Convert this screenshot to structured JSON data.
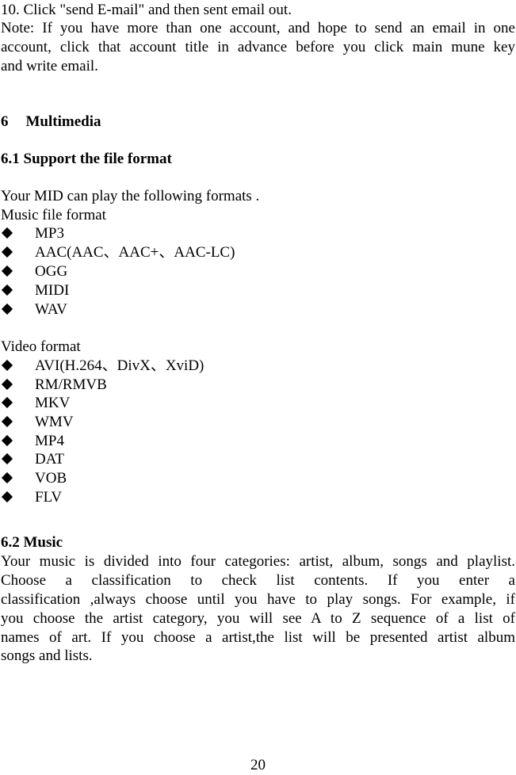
{
  "intro": {
    "step10": "10. Click \"send E-mail\" and then sent email out.",
    "note_lines": [
      "Note: If you have more than one account, and hope to send an email in one",
      "account, click that account title in advance before you click main mune key",
      "and write email."
    ]
  },
  "section6": {
    "heading_number": "6",
    "heading_title": "Multimedia"
  },
  "section6_1": {
    "heading": "6.1 Support the file format",
    "intro": "Your MID can play the following formats .",
    "music_label": "Music file format",
    "music_formats": [
      "MP3",
      "AAC(AAC、AAC+、AAC-LC)",
      "OGG",
      "MIDI",
      "WAV"
    ],
    "video_label": "Video format",
    "video_formats": [
      "AVI(H.264、DivX、XviD)",
      "RM/RMVB",
      "MKV",
      "WMV",
      "MP4",
      "DAT",
      "VOB",
      "FLV"
    ]
  },
  "section6_2": {
    "heading": "6.2 Music",
    "body_lines": [
      "Your music is divided into four categories: artist, album, songs and playlist.",
      "Choose a classification to check list contents. If you enter a",
      "classification ,always choose until you have to play songs. For example, if",
      "you choose the artist category, you will see A to Z sequence of a list of",
      "names of art. If you choose a artist,the list will be presented artist album",
      "songs and lists."
    ]
  },
  "footer": {
    "page_number": "20"
  },
  "icons": {
    "bullet": "black-diamond"
  }
}
